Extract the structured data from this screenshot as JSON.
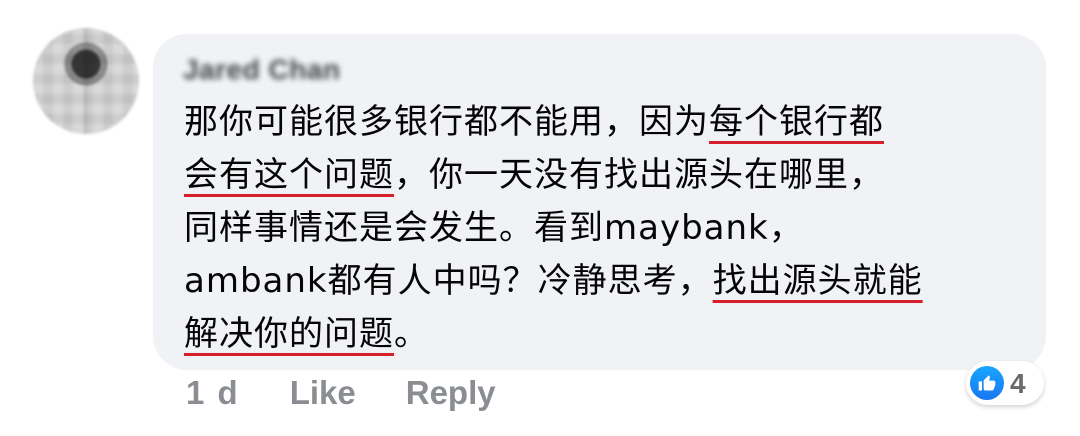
{
  "comment": {
    "author_name": "Jared Chan",
    "message_lines": [
      [
        {
          "text": "那你可能很多银行都不能用，因为",
          "underline": false
        },
        {
          "text": "每个银行都",
          "underline": true
        }
      ],
      [
        {
          "text": "会有这个问题",
          "underline": true
        },
        {
          "text": "，你一天没有找出源头在哪里，",
          "underline": false
        }
      ],
      [
        {
          "text": "同样事情还是会发生。看到maybank，",
          "underline": false
        }
      ],
      [
        {
          "text": "ambank都有人中吗？冷静思考，",
          "underline": false
        },
        {
          "text": "找出源头就能",
          "underline": true
        }
      ],
      [
        {
          "text": "解决你的问题",
          "underline": true
        },
        {
          "text": "。",
          "underline": false
        }
      ]
    ],
    "time_ago": "1 d",
    "like_label": "Like",
    "reply_label": "Reply",
    "reaction_count": "4",
    "colors": {
      "bubble_bg": "#f0f2f5",
      "text": "#050505",
      "muted": "#8a8d91",
      "underline": "#d61f2c",
      "reaction_blue": "#1877f2"
    },
    "icons": {
      "reaction": "thumbs-up-icon"
    }
  }
}
